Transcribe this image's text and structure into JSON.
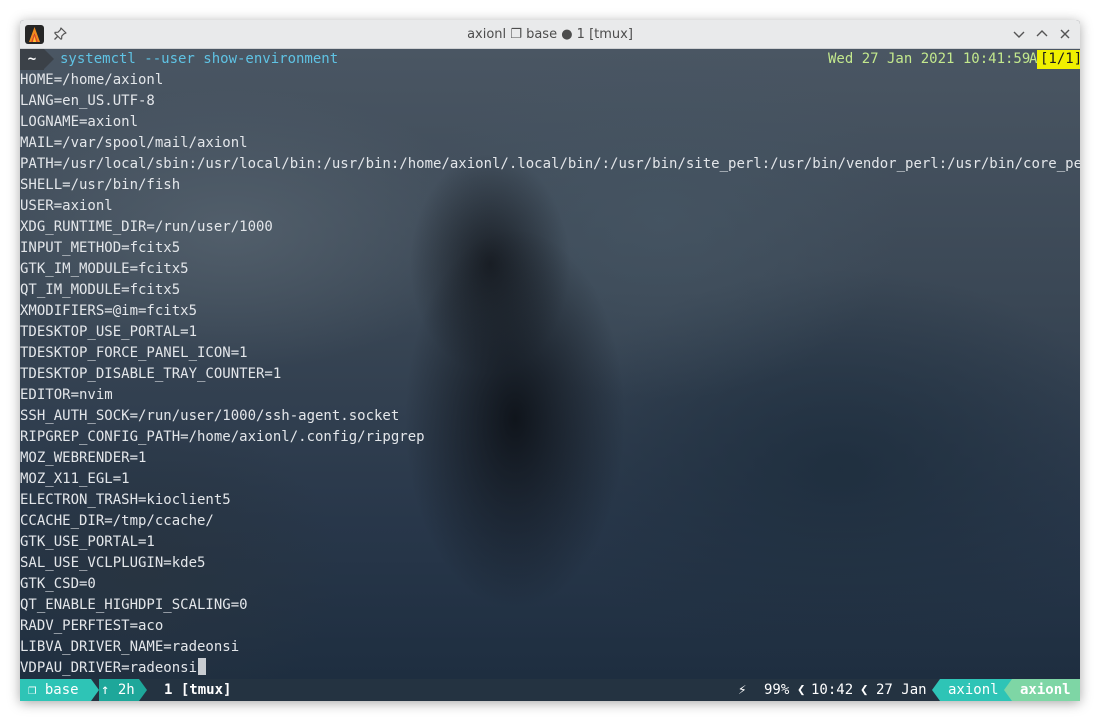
{
  "window": {
    "title": "axionl ❐ base ● 1 [tmux]",
    "icons": {
      "app": "alacritty-icon",
      "pin": "pin-icon",
      "minimize": "chevron-down-icon",
      "maximize": "chevron-up-icon",
      "close": "close-icon"
    }
  },
  "prompt": {
    "dir": "~",
    "command": "systemctl --user show-environment",
    "datetime": "Wed 27 Jan 2021 10:41:59",
    "trailing": "A",
    "pager": "[1/1]"
  },
  "env_lines": [
    "HOME=/home/axionl",
    "LANG=en_US.UTF-8",
    "LOGNAME=axionl",
    "MAIL=/var/spool/mail/axionl",
    "PATH=/usr/local/sbin:/usr/local/bin:/usr/bin:/home/axionl/.local/bin/:/usr/bin/site_perl:/usr/bin/vendor_perl:/usr/bin/core_perl",
    "SHELL=/usr/bin/fish",
    "USER=axionl",
    "XDG_RUNTIME_DIR=/run/user/1000",
    "INPUT_METHOD=fcitx5",
    "GTK_IM_MODULE=fcitx5",
    "QT_IM_MODULE=fcitx5",
    "XMODIFIERS=@im=fcitx5",
    "TDESKTOP_USE_PORTAL=1",
    "TDESKTOP_FORCE_PANEL_ICON=1",
    "TDESKTOP_DISABLE_TRAY_COUNTER=1",
    "EDITOR=nvim",
    "SSH_AUTH_SOCK=/run/user/1000/ssh-agent.socket",
    "RIPGREP_CONFIG_PATH=/home/axionl/.config/ripgrep",
    "MOZ_WEBRENDER=1",
    "MOZ_X11_EGL=1",
    "ELECTRON_TRASH=kioclient5",
    "CCACHE_DIR=/tmp/ccache/",
    "GTK_USE_PORTAL=1",
    "SAL_USE_VCLPLUGIN=kde5",
    "GTK_CSD=0",
    "QT_ENABLE_HIGHDPI_SCALING=0",
    "RADV_PERFTEST=aco",
    "LIBVA_DRIVER_NAME=radeonsi",
    "VDPAU_DRIVER=radeonsi"
  ],
  "statusbar": {
    "session": "❐ base",
    "uptime": "↑ 2h",
    "window": "1 [tmux]",
    "battery_icon": "⚡",
    "battery": "99%",
    "time": "10:42",
    "date": "27 Jan",
    "user": "axionl",
    "host": "axionl",
    "colors": {
      "session_bg": "#2ec4b6",
      "uptime_bg": "#1ea79a",
      "user_bg": "#2ec4b6",
      "host_bg": "#7ed6a5"
    }
  }
}
